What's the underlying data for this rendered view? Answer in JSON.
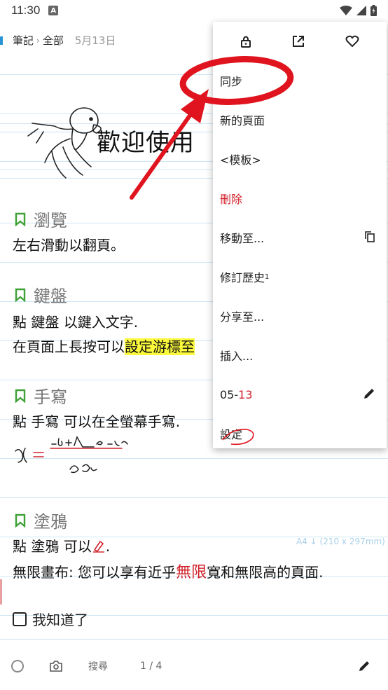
{
  "status_bar": {
    "time": "11:30",
    "a_icon": "A"
  },
  "breadcrumb": {
    "root": "筆記",
    "folder": "全部",
    "date": "5月13日"
  },
  "note": {
    "welcome": "歡迎使用",
    "sections": [
      {
        "heading": "瀏覽",
        "lines": [
          "左右滑動以翻頁。"
        ]
      },
      {
        "heading": "鍵盤",
        "line1": "點 鍵盤 以鍵入文字.",
        "line2_pre": "在頁面上長按可以",
        "line2_highlight": "設定游標至"
      },
      {
        "heading": "手寫",
        "lines": [
          "點 手寫 可以在全螢幕手寫."
        ]
      },
      {
        "heading": "塗鴉",
        "line1_pre": "點 塗鴉 可以",
        "line1_post": ".",
        "line2_pre": "無限畫布: 您可以享有近乎",
        "line2_big": "無限",
        "line2_post": "寬和無限高的頁面."
      }
    ],
    "paper_size": "A4 ↓ (210 x 297mm)",
    "checkbox_label": "我知道了"
  },
  "bottom_bar": {
    "search": "搜尋",
    "page": "1 / 4"
  },
  "menu": {
    "items": [
      {
        "label": "同步"
      },
      {
        "label": "新的頁面"
      },
      {
        "label": "<模板>"
      },
      {
        "label": "刪除"
      },
      {
        "label": "移動至..."
      },
      {
        "label": "修訂歷史",
        "sup": "1"
      },
      {
        "label": "分享至..."
      },
      {
        "label": "插入..."
      },
      {
        "label_pre": "05-",
        "label_red": "13"
      },
      {
        "label": "設定"
      }
    ]
  },
  "colors": {
    "accent": "#2a93d5",
    "ruling": "#cfe6f4",
    "bookmark": "#3fa136",
    "danger": "#d0202a",
    "highlight": "#fbf93c",
    "annotation": "#e0141e"
  },
  "icons": [
    "lock-icon",
    "open-external-icon",
    "heart-icon",
    "copy-icon",
    "pencil-icon",
    "camera-icon",
    "bookmark-icon",
    "circle-icon"
  ]
}
